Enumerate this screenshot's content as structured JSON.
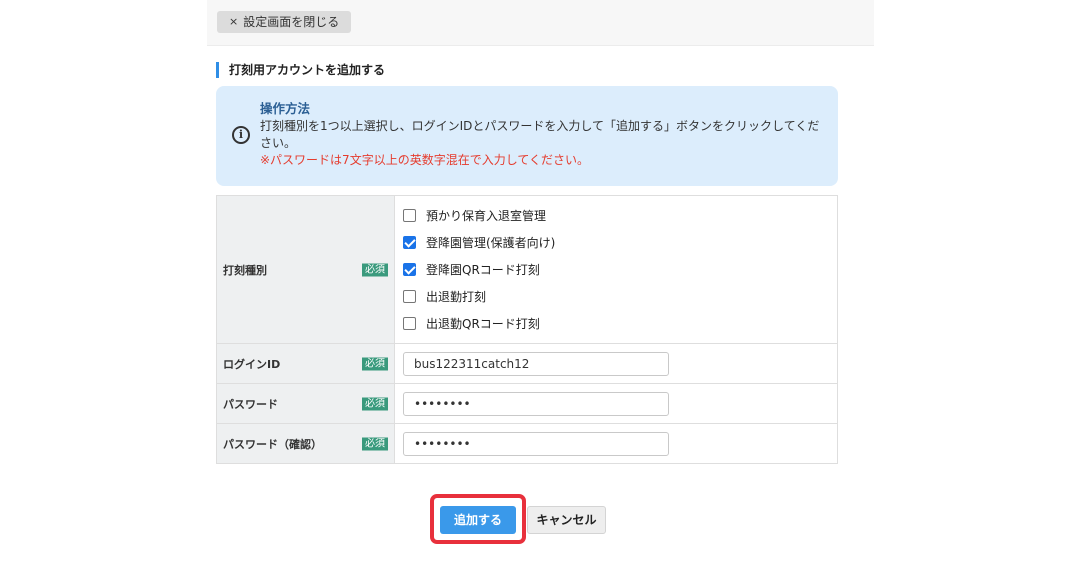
{
  "topbar": {
    "close_icon": "×",
    "close_label": "設定画面を閉じる"
  },
  "section": {
    "title": "打刻用アカウントを追加する"
  },
  "info": {
    "icon": "i",
    "heading": "操作方法",
    "line1": "打刻種別を1つ以上選択し、ログインIDとパスワードを入力して「追加する」ボタンをクリックしてください。",
    "warning": "※パスワードは7文字以上の英数字混在で入力してください。"
  },
  "form": {
    "required_label": "必須",
    "type_label": "打刻種別",
    "types": [
      {
        "label": "預かり保育入退室管理",
        "checked": false
      },
      {
        "label": "登降園管理(保護者向け)",
        "checked": true
      },
      {
        "label": "登降園QRコード打刻",
        "checked": true
      },
      {
        "label": "出退勤打刻",
        "checked": false
      },
      {
        "label": "出退勤QRコード打刻",
        "checked": false
      }
    ],
    "login_label": "ログインID",
    "login_value": "bus122311catch12",
    "password_label": "パスワード",
    "password_value": "••••••••",
    "password_confirm_label": "パスワード（確認）",
    "password_confirm_value": "••••••••"
  },
  "actions": {
    "add_label": "追加する",
    "cancel_label": "キャンセル"
  },
  "colors": {
    "accent": "#3a99ea",
    "required_badge": "#3a9a7d",
    "warning": "#e53c2e",
    "highlight": "#e8303c"
  }
}
